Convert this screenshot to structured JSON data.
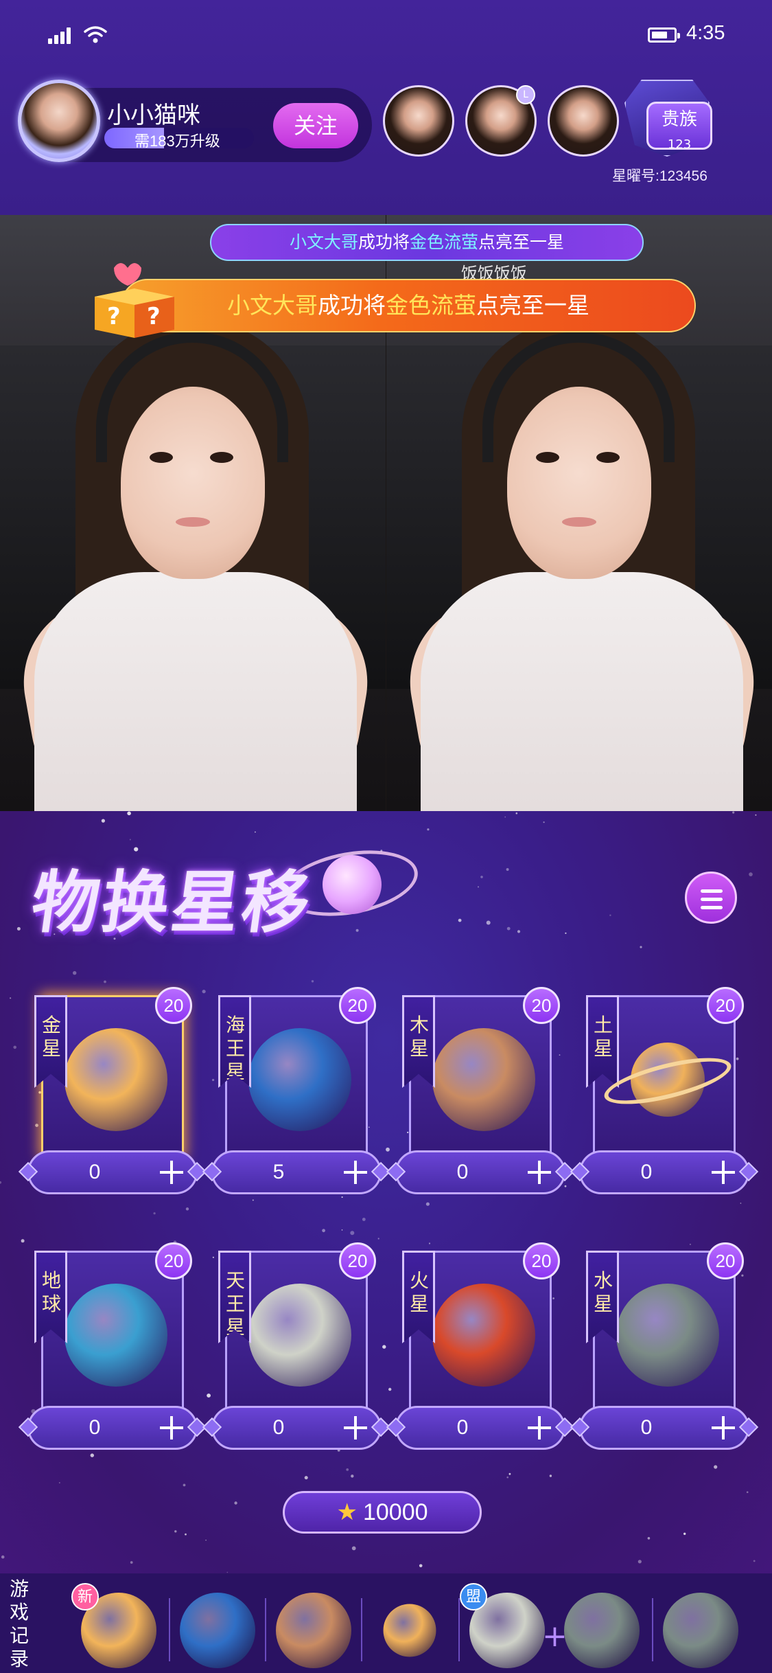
{
  "status_bar": {
    "time": "4:35"
  },
  "host": {
    "name": "小小猫咪",
    "level_hint": "需183万升级",
    "level_progress": 0.4,
    "follow_label": "关注"
  },
  "audience": [
    {
      "badge": ""
    },
    {
      "badge": "L"
    },
    {
      "badge": ""
    }
  ],
  "noble": {
    "title": "贵族",
    "level": "123",
    "star_id_label": "星曜号:",
    "star_id": "123456"
  },
  "banners": {
    "small": {
      "user": "小文大哥",
      "mid": "成功将",
      "item": "金色流萤",
      "end": "点亮至一星"
    },
    "big": {
      "user": "小文大哥",
      "mid": "成功将",
      "item": "金色流萤",
      "end": "点亮至一星"
    }
  },
  "video": {
    "user_tag": "饭饭饭饭"
  },
  "game": {
    "title": "物换星移",
    "planets": [
      {
        "name": "金星",
        "count": "20",
        "value": "0",
        "color": "#f2b45a",
        "selected": true
      },
      {
        "name": "海王星",
        "count": "20",
        "value": "5",
        "color": "#2f6fc6",
        "selected": false
      },
      {
        "name": "木星",
        "count": "20",
        "value": "0",
        "color": "#c98b62",
        "selected": false
      },
      {
        "name": "土星",
        "count": "20",
        "value": "0",
        "color": "#f0b15a",
        "selected": false
      },
      {
        "name": "地球",
        "count": "20",
        "value": "0",
        "color": "#3a9fd0",
        "selected": false
      },
      {
        "name": "天王星",
        "count": "20",
        "value": "0",
        "color": "#cfd2c8",
        "selected": false
      },
      {
        "name": "火星",
        "count": "20",
        "value": "0",
        "color": "#d9492a",
        "selected": false
      },
      {
        "name": "水星",
        "count": "20",
        "value": "0",
        "color": "#7b8b86",
        "selected": false
      }
    ],
    "balance": "10000"
  },
  "history": {
    "label": "游戏记录",
    "items": [
      {
        "planet": "金星",
        "badge": "新"
      },
      {
        "planet": "海王星",
        "badge": ""
      },
      {
        "planet": "木星",
        "badge": ""
      },
      {
        "planet": "土星",
        "badge": ""
      },
      {
        "planet": "天王星",
        "badge": "盟"
      },
      {
        "planet": "水星",
        "badge": ""
      },
      {
        "planet": "水星",
        "badge": ""
      }
    ]
  },
  "colors": {
    "accent": "#c234dd",
    "banner_orange": "#f46a1a",
    "highlight_gold": "#ffe55a",
    "highlight_blue": "#7ff3ff"
  }
}
